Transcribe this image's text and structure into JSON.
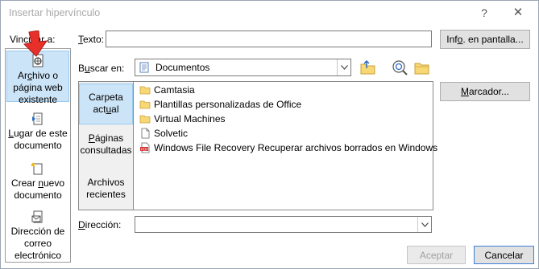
{
  "dialog": {
    "title": "Insertar hipervínculo",
    "help": "?",
    "close": "✕"
  },
  "link_to": {
    "label_pre": "Vincul",
    "label_ul": "a",
    "label_post": "r a:",
    "items": [
      {
        "line1_pre": "Ar",
        "line1_ul": "c",
        "line1_post": "hivo o",
        "line2": "página web",
        "line3": "existente",
        "icon": "web-page-icon"
      },
      {
        "line1_pre": "",
        "line1_ul": "L",
        "line1_post": "ugar de este",
        "line2": "documento",
        "icon": "place-in-document-icon"
      },
      {
        "line1_pre": "Crear ",
        "line1_ul": "n",
        "line1_post": "uevo",
        "line2": "documento",
        "icon": "new-document-icon"
      },
      {
        "line1_pre": "Dirección de",
        "line1_ul": "",
        "line1_post": "",
        "line2": "correo",
        "line3": "electrónico",
        "icon": "email-icon"
      }
    ]
  },
  "texto": {
    "label_ul": "T",
    "label_post": "exto:",
    "value": ""
  },
  "screen_tip_button": {
    "pre": "Inf",
    "ul": "o",
    "post": ". en pantalla..."
  },
  "buscar_en": {
    "label_pre": "B",
    "label_ul": "u",
    "label_post": "scar en:",
    "value": "Documentos",
    "icon": "folder-documents-icon"
  },
  "tabs": [
    {
      "line1": "Carpeta",
      "line2_pre": "act",
      "line2_ul": "u",
      "line2_post": "al"
    },
    {
      "line1_pre": "",
      "line1_ul": "P",
      "line1_post": "áginas",
      "line2": "consultadas"
    },
    {
      "line1": "Archivos",
      "line2": "recientes"
    }
  ],
  "files": [
    {
      "name": "Camtasia",
      "type": "folder"
    },
    {
      "name": "Plantillas personalizadas de Office",
      "type": "folder"
    },
    {
      "name": "Virtual Machines",
      "type": "folder"
    },
    {
      "name": "Solvetic",
      "type": "file"
    },
    {
      "name": "Windows File Recovery Recuperar archivos borrados en Windows",
      "type": "pdf"
    }
  ],
  "bookmark_button": {
    "pre": "",
    "ul": "M",
    "post": "arcador..."
  },
  "direccion": {
    "label_ul": "D",
    "label_post": "irección:",
    "value": ""
  },
  "accept_label": "Aceptar",
  "cancel_label": "Cancelar",
  "colors": {
    "selected_bg": "#cce4f7",
    "selected_border": "#99c9ef",
    "arrow": "#e8302a",
    "folder": "#f8d775"
  }
}
